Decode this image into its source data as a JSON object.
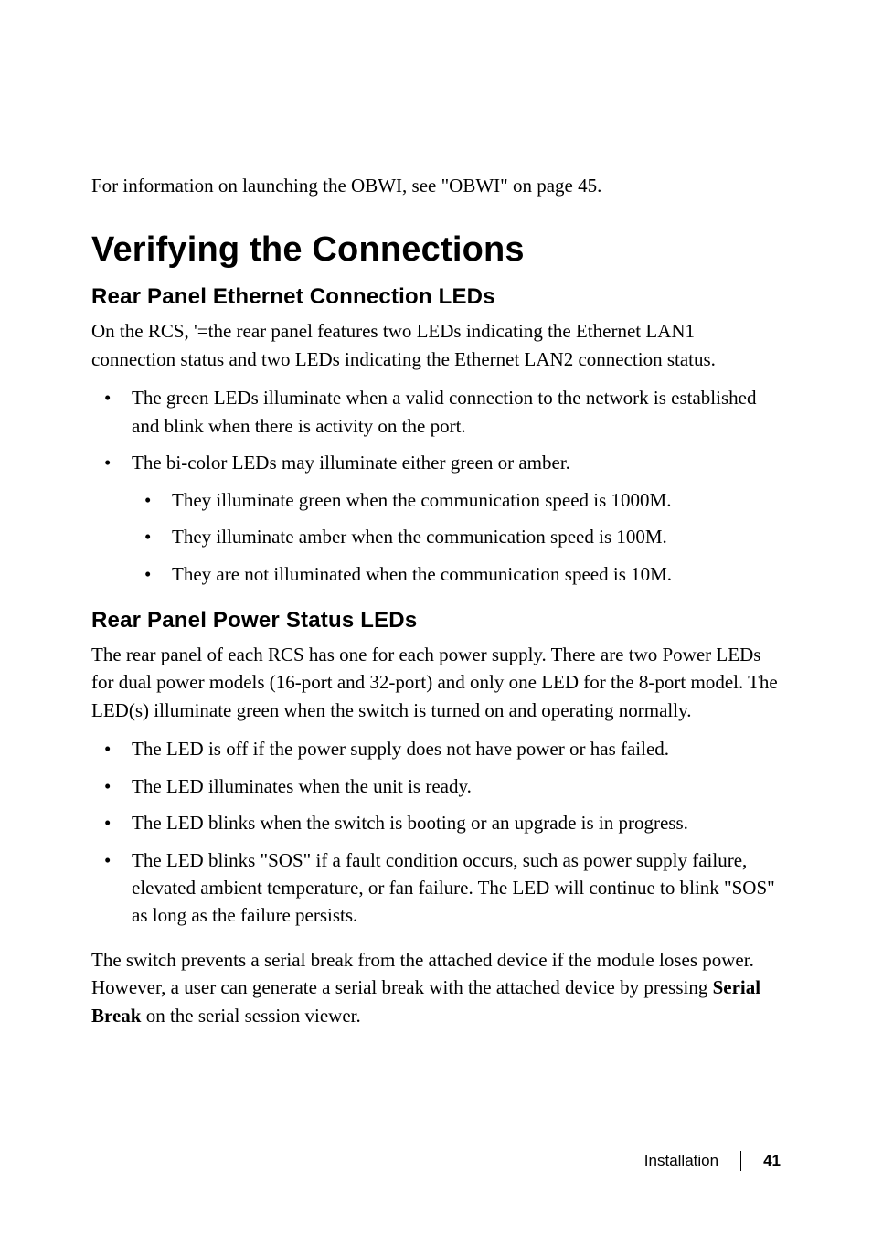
{
  "intro": "For information on launching the OBWI, see \"OBWI\" on page 45.",
  "h1": "Verifying the Connections",
  "section1": {
    "heading": "Rear Panel Ethernet Connection LEDs",
    "para": "On the RCS, '=the rear panel features two LEDs indicating the Ethernet LAN1 connection status and two LEDs indicating the Ethernet LAN2 connection status.",
    "bullets": [
      "The green LEDs illuminate when a valid connection to the network is established and blink when there is activity on the port.",
      "The bi-color LEDs may illuminate either green or amber."
    ],
    "sub_bullets": [
      "They illuminate green when the communication speed is 1000M.",
      "They illuminate amber when the communication speed is 100M.",
      "They are not illuminated when the communication speed is 10M."
    ]
  },
  "section2": {
    "heading": "Rear Panel Power Status LEDs",
    "para": "The rear panel of each RCS has one for each power supply. There are two Power LEDs for dual power models (16-port and 32-port) and only one LED for the 8-port model. The LED(s) illuminate green when the switch is turned on and operating normally.",
    "bullets": [
      "The LED is off if the power supply does not have power or has failed.",
      "The LED illuminates when the unit is ready.",
      "The LED blinks when the switch is booting or an upgrade is in progress.",
      "The LED blinks \"SOS\" if a fault condition occurs, such as power supply failure, elevated ambient temperature, or fan failure. The LED will continue to blink \"SOS\" as long as the failure persists."
    ],
    "closing_pre": "The switch prevents a serial break from the attached device if the module loses power. However, a user can generate a serial break with the attached device by pressing ",
    "closing_bold": "Serial Break",
    "closing_post": " on the serial session viewer."
  },
  "footer": {
    "section": "Installation",
    "page": "41"
  }
}
